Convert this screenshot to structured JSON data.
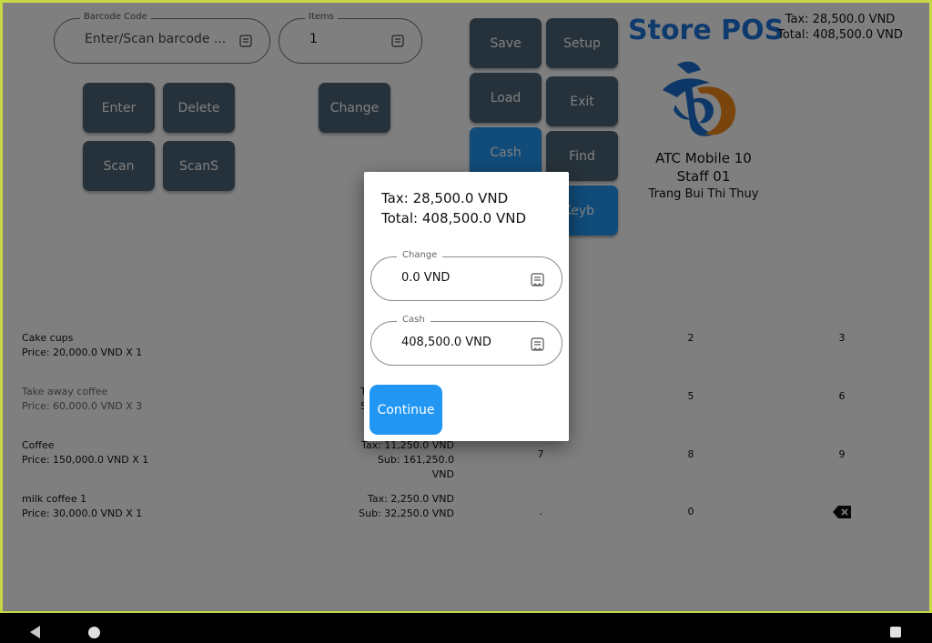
{
  "header": {
    "title": "Store POS",
    "tax": "Tax: 28,500.0 VND",
    "total": "Total: 408,500.0 VND"
  },
  "barcode": {
    "label": "Barcode Code",
    "placeholder": "Enter/Scan barcode ..."
  },
  "items": {
    "label": "Items",
    "value": "1"
  },
  "left_buttons": {
    "enter": "Enter",
    "delete": "Delete",
    "change": "Change",
    "scan": "Scan",
    "scans": "ScanS"
  },
  "right_buttons": {
    "save": "Save",
    "setup": "Setup",
    "load": "Load",
    "exit": "Exit",
    "cash": "Cash",
    "find": "Find",
    "keyb": "Keyb"
  },
  "store_info": {
    "name": "ATC Mobile 10",
    "staff": "Staff 01",
    "person": "Trang Bui Thi Thuy"
  },
  "order_items": [
    {
      "name": "Cake cups",
      "price": "Price: 20,000.0 VND X 1",
      "tax": "",
      "sub": ""
    },
    {
      "name": "Take away coffee",
      "price": "Price: 60,000.0 VND X 3",
      "tax": "T",
      "sub": "S"
    },
    {
      "name": "Coffee",
      "price": "Price: 150,000.0 VND X 1",
      "tax": "Tax: 11,250.0 VND",
      "sub": "Sub: 161,250.0 VND"
    },
    {
      "name": "milk coffee 1",
      "price": "Price: 30,000.0 VND X 1",
      "tax": "Tax: 2,250.0 VND",
      "sub": "Sub: 32,250.0 VND"
    }
  ],
  "keypad": {
    "k2": "2",
    "k3": "3",
    "k5": "5",
    "k6": "6",
    "k7": "7",
    "k8": "8",
    "k9": "9",
    "kdot": ".",
    "k0": "0"
  },
  "dialog": {
    "tax": "Tax: 28,500.0 VND",
    "total": "Total: 408,500.0 VND",
    "change_label": "Change",
    "change_value": "0.0 VND",
    "cash_label": "Cash",
    "cash_value": "408,500.0 VND",
    "continue": "Continue"
  },
  "colors": {
    "accent": "#2196f3",
    "button_dark": "#4d6577",
    "title": "#1f74dd",
    "frame": "#c6d844"
  }
}
